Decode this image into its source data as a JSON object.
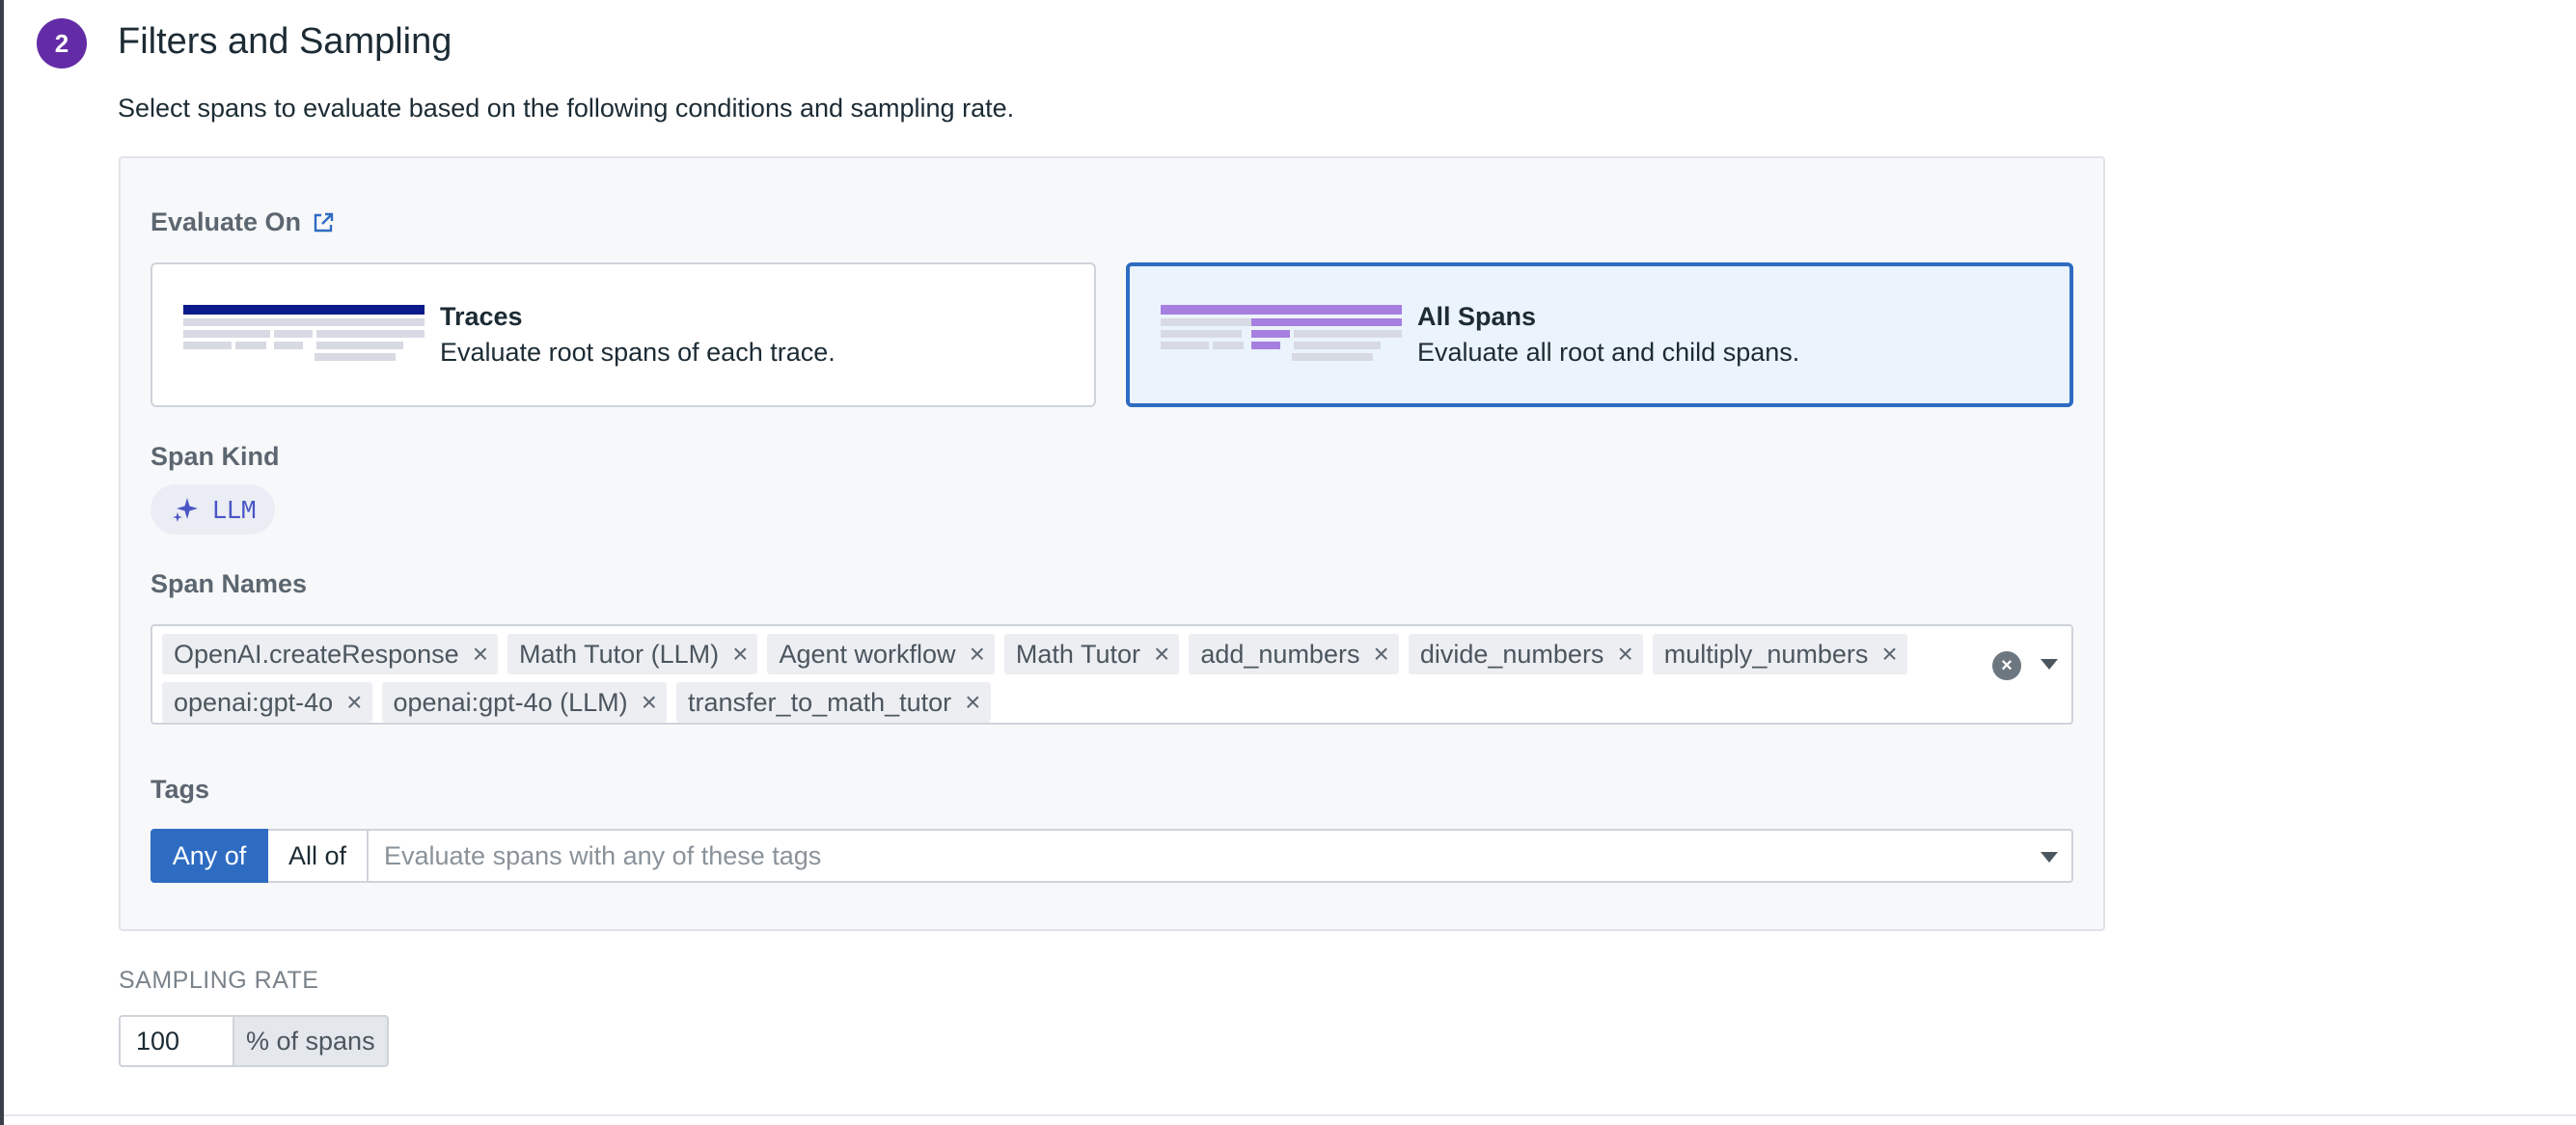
{
  "section": {
    "step_number": "2",
    "title": "Filters and Sampling",
    "subtitle": "Select spans to evaluate based on the following conditions and sampling rate."
  },
  "evaluate_on": {
    "label": "Evaluate On",
    "options": [
      {
        "title": "Traces",
        "description": "Evaluate root spans of each trace.",
        "selected": false
      },
      {
        "title": "All Spans",
        "description": "Evaluate all root and child spans.",
        "selected": true
      }
    ]
  },
  "span_kind": {
    "label": "Span Kind",
    "value": "LLM",
    "icon": "sparkle-icon"
  },
  "span_names": {
    "label": "Span Names",
    "chips": [
      "OpenAI.createResponse",
      "Math Tutor (LLM)",
      "Agent workflow",
      "Math Tutor",
      "add_numbers",
      "divide_numbers",
      "multiply_numbers",
      "openai:gpt-4o",
      "openai:gpt-4o (LLM)",
      "transfer_to_math_tutor"
    ]
  },
  "tags": {
    "label": "Tags",
    "mode_any": "Any of",
    "mode_all": "All of",
    "selected_mode": "Any of",
    "placeholder": "Evaluate spans with any of these tags"
  },
  "sampling": {
    "label": "SAMPLING RATE",
    "value": "100",
    "unit": "% of spans"
  },
  "colors": {
    "accent": "#2e6cc2",
    "step_badge": "#632ca6",
    "traces_bar": "#0b1a8a",
    "spans_bar": "#a77fe0"
  }
}
